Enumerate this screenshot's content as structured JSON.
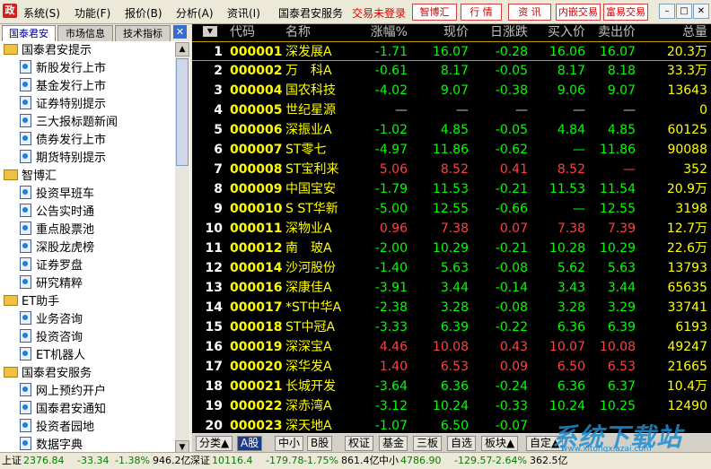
{
  "menubar": {
    "logo_glyph": "政",
    "items": [
      "系统(S)",
      "功能(F)",
      "报价(B)",
      "分析(A)",
      "资讯(I)",
      "国泰君安服务"
    ],
    "login_status": "交易未登录",
    "buttons": [
      "智博汇",
      "行 情",
      "资 讯",
      "内嵌交易",
      "富易交易"
    ],
    "window_controls": [
      "–",
      "□",
      "✕"
    ]
  },
  "left_panel": {
    "tabs": [
      "国泰君安",
      "市场信息",
      "技术指标"
    ],
    "close": "✕",
    "tree": [
      {
        "type": "folder",
        "label": "国泰君安提示"
      },
      {
        "type": "item",
        "label": "新股发行上市"
      },
      {
        "type": "item",
        "label": "基金发行上市"
      },
      {
        "type": "item",
        "label": "证券特别提示"
      },
      {
        "type": "item",
        "label": "三大报标题新闻"
      },
      {
        "type": "item",
        "label": "债券发行上市"
      },
      {
        "type": "item",
        "label": "期货特别提示"
      },
      {
        "type": "folder",
        "label": "智博汇"
      },
      {
        "type": "item",
        "label": "投资早班车"
      },
      {
        "type": "item",
        "label": "公告实时通"
      },
      {
        "type": "item",
        "label": "重点股票池"
      },
      {
        "type": "item",
        "label": "深股龙虎榜"
      },
      {
        "type": "item",
        "label": "证券罗盘"
      },
      {
        "type": "item",
        "label": "研究精粹"
      },
      {
        "type": "folder",
        "label": "ET助手"
      },
      {
        "type": "item",
        "label": "业务咨询"
      },
      {
        "type": "item",
        "label": "投资咨询"
      },
      {
        "type": "item",
        "label": "ET机器人"
      },
      {
        "type": "folder",
        "label": "国泰君安服务"
      },
      {
        "type": "item",
        "label": "网上预约开户"
      },
      {
        "type": "item",
        "label": "国泰君安通知"
      },
      {
        "type": "item",
        "label": "投资者园地"
      },
      {
        "type": "item",
        "label": "数据字典"
      }
    ]
  },
  "table": {
    "menu_glyph": "▼",
    "columns": [
      "代码",
      "名称",
      "涨幅%",
      "现价",
      "日涨跌",
      "买入价",
      "卖出价",
      "总量"
    ],
    "rows": [
      {
        "idx": "1",
        "code": "000001",
        "name": "深发展A",
        "chg": "-1.71",
        "price": "16.07",
        "diff": "-0.28",
        "bid": "16.06",
        "ask": "16.07",
        "vol": "20.3万",
        "dir": "down"
      },
      {
        "idx": "2",
        "code": "000002",
        "name": "万　科A",
        "chg": "-0.61",
        "price": "8.17",
        "diff": "-0.05",
        "bid": "8.17",
        "ask": "8.18",
        "vol": "33.3万",
        "dir": "down"
      },
      {
        "idx": "3",
        "code": "000004",
        "name": "国农科技",
        "chg": "-4.02",
        "price": "9.07",
        "diff": "-0.38",
        "bid": "9.06",
        "ask": "9.07",
        "vol": "13643",
        "dir": "down"
      },
      {
        "idx": "4",
        "code": "000005",
        "name": "世纪星源",
        "chg": "—",
        "price": "—",
        "diff": "—",
        "bid": "—",
        "ask": "—",
        "vol": "0",
        "dir": "flat"
      },
      {
        "idx": "5",
        "code": "000006",
        "name": "深振业A",
        "chg": "-1.02",
        "price": "4.85",
        "diff": "-0.05",
        "bid": "4.84",
        "ask": "4.85",
        "vol": "60125",
        "dir": "down"
      },
      {
        "idx": "6",
        "code": "000007",
        "name": "ST零七",
        "chg": "-4.97",
        "price": "11.86",
        "diff": "-0.62",
        "bid": "—",
        "ask": "11.86",
        "vol": "90088",
        "dir": "down"
      },
      {
        "idx": "7",
        "code": "000008",
        "name": "ST宝利来",
        "chg": "5.06",
        "price": "8.52",
        "diff": "0.41",
        "bid": "8.52",
        "ask": "—",
        "vol": "352",
        "dir": "up"
      },
      {
        "idx": "8",
        "code": "000009",
        "name": "中国宝安",
        "chg": "-1.79",
        "price": "11.53",
        "diff": "-0.21",
        "bid": "11.53",
        "ask": "11.54",
        "vol": "20.9万",
        "dir": "down"
      },
      {
        "idx": "9",
        "code": "000010",
        "name": "S ST华新",
        "chg": "-5.00",
        "price": "12.55",
        "diff": "-0.66",
        "bid": "—",
        "ask": "12.55",
        "vol": "3198",
        "dir": "down"
      },
      {
        "idx": "10",
        "code": "000011",
        "name": "深物业A",
        "chg": "0.96",
        "price": "7.38",
        "diff": "0.07",
        "bid": "7.38",
        "ask": "7.39",
        "vol": "12.7万",
        "dir": "up"
      },
      {
        "idx": "11",
        "code": "000012",
        "name": "南　玻A",
        "chg": "-2.00",
        "price": "10.29",
        "diff": "-0.21",
        "bid": "10.28",
        "ask": "10.29",
        "vol": "22.6万",
        "dir": "down"
      },
      {
        "idx": "12",
        "code": "000014",
        "name": "沙河股份",
        "chg": "-1.40",
        "price": "5.63",
        "diff": "-0.08",
        "bid": "5.62",
        "ask": "5.63",
        "vol": "13793",
        "dir": "down"
      },
      {
        "idx": "13",
        "code": "000016",
        "name": "深康佳A",
        "chg": "-3.91",
        "price": "3.44",
        "diff": "-0.14",
        "bid": "3.43",
        "ask": "3.44",
        "vol": "65635",
        "dir": "down"
      },
      {
        "idx": "14",
        "code": "000017",
        "name": "*ST中华A",
        "chg": "-2.38",
        "price": "3.28",
        "diff": "-0.08",
        "bid": "3.28",
        "ask": "3.29",
        "vol": "33741",
        "dir": "down"
      },
      {
        "idx": "15",
        "code": "000018",
        "name": "ST中冠A",
        "chg": "-3.33",
        "price": "6.39",
        "diff": "-0.22",
        "bid": "6.36",
        "ask": "6.39",
        "vol": "6193",
        "dir": "down"
      },
      {
        "idx": "16",
        "code": "000019",
        "name": "深深宝A",
        "chg": "4.46",
        "price": "10.08",
        "diff": "0.43",
        "bid": "10.07",
        "ask": "10.08",
        "vol": "49247",
        "dir": "up"
      },
      {
        "idx": "17",
        "code": "000020",
        "name": "深华发A",
        "chg": "1.40",
        "price": "6.53",
        "diff": "0.09",
        "bid": "6.50",
        "ask": "6.53",
        "vol": "21665",
        "dir": "up"
      },
      {
        "idx": "18",
        "code": "000021",
        "name": "长城开发",
        "chg": "-3.64",
        "price": "6.36",
        "diff": "-0.24",
        "bid": "6.36",
        "ask": "6.37",
        "vol": "10.4万",
        "dir": "down"
      },
      {
        "idx": "19",
        "code": "000022",
        "name": "深赤湾A",
        "chg": "-3.12",
        "price": "10.24",
        "diff": "-0.33",
        "bid": "10.24",
        "ask": "10.25",
        "vol": "12490",
        "dir": "down"
      },
      {
        "idx": "20",
        "code": "000023",
        "name": "深天地A",
        "chg": "-1.07",
        "price": "6.50",
        "diff": "-0.07",
        "bid": "",
        "ask": "",
        "vol": "",
        "dir": "down"
      }
    ]
  },
  "bottom_tabs": [
    "分类▲",
    "A股",
    "中小",
    "B股",
    "权证",
    "基金",
    "三板",
    "自选",
    "板块▲",
    "自定▲"
  ],
  "watermark": "系统下载站",
  "watermark_url": "www.xitongxiazai.com",
  "status": [
    {
      "name": "上证",
      "value": "2376.84",
      "change": "-33.34",
      "pct": "-1.38%",
      "amount": "946.2亿"
    },
    {
      "name": "深证",
      "value": "10116.4",
      "change": "-179.78",
      "pct": "-1.75%",
      "amount": "861.4亿"
    },
    {
      "name": "中小",
      "value": "4786.90",
      "change": "-129.57",
      "pct": "-2.64%",
      "amount": "362.5亿"
    }
  ],
  "colors": {
    "up": "#ff4040",
    "down": "#00ff00",
    "code": "#ffff00",
    "background": "#000000"
  }
}
